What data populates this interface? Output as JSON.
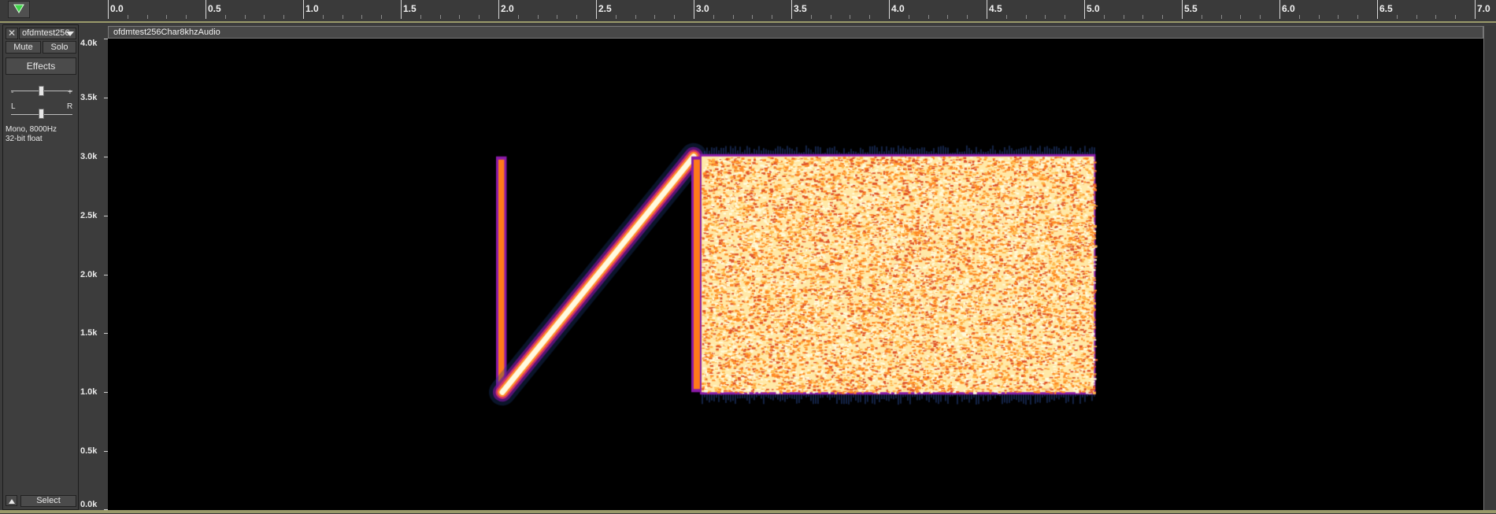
{
  "ruler": {
    "ticks": [
      "0.0",
      "0.5",
      "1.0",
      "1.5",
      "2.0",
      "2.5",
      "3.0",
      "3.5",
      "4.0",
      "4.5",
      "5.0",
      "5.5",
      "6.0",
      "6.5",
      "7.0"
    ]
  },
  "track": {
    "name": "ofdmtest256",
    "close_label": "✕",
    "mute_label": "Mute",
    "solo_label": "Solo",
    "effects_label": "Effects",
    "gain_minus": "-",
    "gain_plus": "+",
    "pan_left": "L",
    "pan_right": "R",
    "info_line1": "Mono, 8000Hz",
    "info_line2": "32-bit float",
    "select_label": "Select"
  },
  "clip": {
    "name": "ofdmtest256Char8khzAudio"
  },
  "freq_scale": {
    "labels": [
      "4.0k",
      "3.5k",
      "3.0k",
      "2.5k",
      "2.0k",
      "1.5k",
      "1.0k",
      "0.5k",
      "0.0k"
    ]
  },
  "spectrogram": {
    "time_range_s": [
      0,
      7.0
    ],
    "freq_range_hz": [
      0,
      4000
    ],
    "segments": [
      {
        "kind": "tone",
        "t_start": 2.0,
        "t_end": 2.03,
        "f_low": 1000,
        "f_high": 3000
      },
      {
        "kind": "chirp",
        "t_start": 2.02,
        "t_end": 3.0,
        "f_start": 1000,
        "f_end": 3000
      },
      {
        "kind": "tone",
        "t_start": 3.0,
        "t_end": 3.04,
        "f_low": 1000,
        "f_high": 3000
      },
      {
        "kind": "noise-block",
        "t_start": 3.04,
        "t_end": 5.05,
        "f_low": 1000,
        "f_high": 3000
      }
    ],
    "colors": {
      "background": "#000000",
      "low": "#8a1aa8",
      "mid": "#ff7a1a",
      "high": "#fffbd8"
    }
  }
}
